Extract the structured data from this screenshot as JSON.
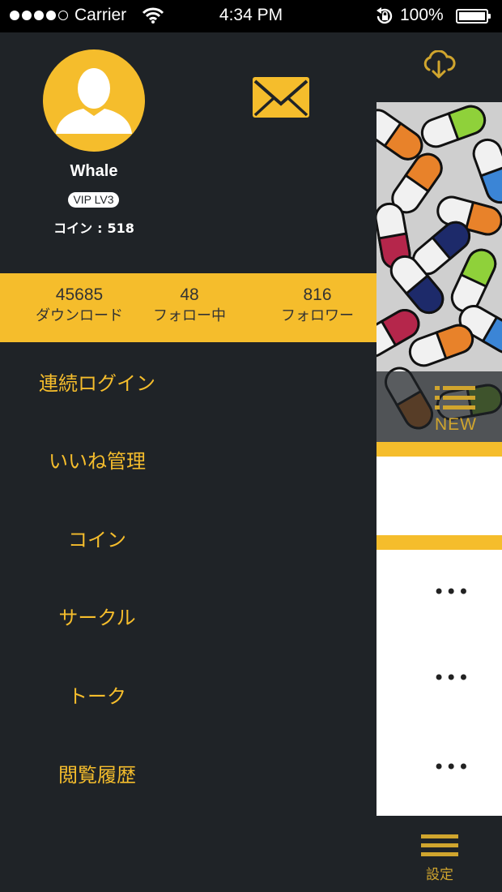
{
  "status_bar": {
    "carrier": "Carrier",
    "time": "4:34 PM",
    "battery": "100%",
    "signal_bars_filled": 4,
    "signal_bars_total": 5
  },
  "profile": {
    "username": "Whale",
    "vip_level": "VIP LV3",
    "coin_label": "コイン",
    "coin_separator": ":",
    "coin_value": "518"
  },
  "stats": [
    {
      "value": "45685",
      "label": "ダウンロード"
    },
    {
      "value": "48",
      "label": "フォロー中"
    },
    {
      "value": "816",
      "label": "フォロワー"
    }
  ],
  "menu": [
    {
      "label": "連続ログイン"
    },
    {
      "label": "いいね管理"
    },
    {
      "label": "コイン"
    },
    {
      "label": "サークル"
    },
    {
      "label": "トーク"
    },
    {
      "label": "閲覧履歴"
    }
  ],
  "background_panel": {
    "new_label": "NEW",
    "more_glyph": "•••",
    "settings_label": "設定"
  },
  "icons": {
    "avatar": "user-silhouette-icon",
    "mail": "envelope-icon",
    "cloud": "cloud-download-icon",
    "new": "list-icon",
    "settings": "hamburger-menu-icon"
  },
  "colors": {
    "accent": "#f5bd2c",
    "dark": "#1f2327",
    "text_on_accent": "#333333"
  }
}
